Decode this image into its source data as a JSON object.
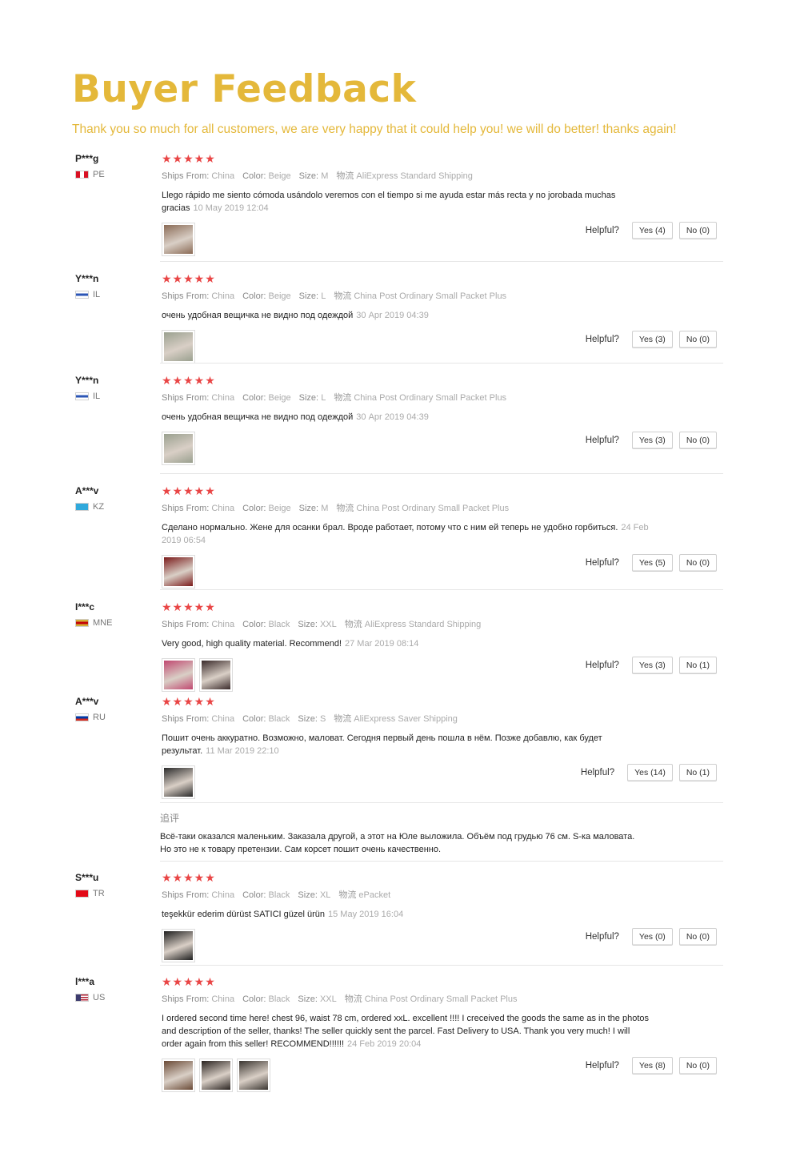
{
  "header": {
    "title": "Buyer Feedback",
    "subtitle": "Thank you so much for all customers, we are very happy that it could help you! we will do better! thanks again!"
  },
  "labels": {
    "ships_from": "Ships From:",
    "color": "Color:",
    "size": "Size:",
    "shipping_icon": "物流",
    "helpful": "Helpful?",
    "followup": "追评"
  },
  "reviews": [
    {
      "user": "P***g",
      "country": "PE",
      "flag_colors": [
        "#d91023",
        "#ffffff",
        "#d91023"
      ],
      "flag_icon": "peru-flag-icon",
      "stars": "★★★★★",
      "ships_from": "China",
      "color": "Beige",
      "size": "M",
      "shipping": "AliExpress Standard Shipping",
      "text": "Llego rápido me siento cómoda usándolo veremos con el tiempo si me ayuda estar más recta y no jorobada muchas gracias",
      "date": "10 May 2019 12:04",
      "thumbs": [
        "#8a6a55"
      ],
      "yes": "Yes (4)",
      "no": "No (0)"
    },
    {
      "user": "Y***n",
      "country": "IL",
      "flag_colors": [
        "#ffffff",
        "#2b55b5",
        "#ffffff"
      ],
      "flag_icon": "israel-flag-icon",
      "stars": "★★★★★",
      "ships_from": "China",
      "color": "Beige",
      "size": "L",
      "shipping": "China Post Ordinary Small Packet Plus",
      "text": "очень удобная вещичка не видно под одеждой",
      "date": "30 Apr 2019 04:39",
      "thumbs": [
        "#9aa08f"
      ],
      "yes": "Yes (3)",
      "no": "No (0)"
    },
    {
      "user": "Y***n",
      "country": "IL",
      "flag_colors": [
        "#ffffff",
        "#2b55b5",
        "#ffffff"
      ],
      "flag_icon": "israel-flag-icon",
      "stars": "★★★★★",
      "ships_from": "China",
      "color": "Beige",
      "size": "L",
      "shipping": "China Post Ordinary Small Packet Plus",
      "text": "очень удобная вещичка не видно под одеждой",
      "date": "30 Apr 2019 04:39",
      "thumbs": [
        "#9aa08f"
      ],
      "yes": "Yes (3)",
      "no": "No (0)"
    },
    {
      "user": "A***v",
      "country": "KZ",
      "flag_colors": [
        "#30a9dc",
        "#30a9dc",
        "#30a9dc"
      ],
      "flag_icon": "kazakhstan-flag-icon",
      "stars": "★★★★★",
      "ships_from": "China",
      "color": "Beige",
      "size": "M",
      "shipping": "China Post Ordinary Small Packet Plus",
      "text": "Сделано нормально. Жене для осанки брал. Вроде работает, потому что с ним ей теперь не удобно горбиться.",
      "date": "24 Feb 2019 06:54",
      "thumbs": [
        "#7a1a1a"
      ],
      "yes": "Yes (5)",
      "no": "No (0)"
    },
    {
      "user": "I***c",
      "country": "MNE",
      "flag_colors": [
        "#d4af37",
        "#c40308",
        "#d4af37"
      ],
      "flag_icon": "montenegro-flag-icon",
      "stars": "★★★★★",
      "ships_from": "China",
      "color": "Black",
      "size": "XXL",
      "shipping": "AliExpress Standard Shipping",
      "text": "Very good, high quality material. Recommend!",
      "date": "27 Mar 2019 08:14",
      "thumbs": [
        "#c04870",
        "#3a2a2a"
      ],
      "yes": "Yes (3)",
      "no": "No (1)"
    },
    {
      "user": "A***v",
      "country": "RU",
      "flag_colors": [
        "#ffffff",
        "#0039a6",
        "#d52b1e"
      ],
      "flag_icon": "russia-flag-icon",
      "stars": "★★★★★",
      "ships_from": "China",
      "color": "Black",
      "size": "S",
      "shipping": "AliExpress Saver Shipping",
      "text": "Пошит очень аккуратно. Возможно, маловат. Сегодня первый день пошла в нём. Позже добавлю, как будет результат.",
      "date": "11 Mar 2019 22:10",
      "thumbs": [
        "#2a2a2a"
      ],
      "yes": "Yes (14)",
      "no": "No (1)",
      "followup": "Всё-таки оказался маленьким. Заказала другой, а этот на Юле выложила. Объём под грудью 76 см. S-ка маловата. Но это не к товару претензии. Сам корсет пошит очень качественно."
    },
    {
      "user": "S***u",
      "country": "TR",
      "flag_colors": [
        "#e30a17",
        "#e30a17",
        "#e30a17"
      ],
      "flag_icon": "turkey-flag-icon",
      "stars": "★★★★★",
      "ships_from": "China",
      "color": "Black",
      "size": "XL",
      "shipping": "ePacket",
      "text": "teşekkür ederim dürüst SATICI güzel ürün",
      "date": "15 May 2019 16:04",
      "thumbs": [
        "#1e1e1e"
      ],
      "yes": "Yes (0)",
      "no": "No (0)"
    },
    {
      "user": "l***a",
      "country": "US",
      "flag_colors": [
        "#b22234",
        "#ffffff",
        "#3c3b6e"
      ],
      "flag_icon": "usa-flag-icon",
      "stars": "★★★★★",
      "ships_from": "China",
      "color": "Black",
      "size": "XXL",
      "shipping": "China Post Ordinary Small Packet Plus",
      "text": "I ordered second time here! chest 96, waist 78 cm, ordered xxL. excellent !!!! I creceived the goods the same as in the photos and description of the seller, thanks! The seller quickly sent the parcel. Fast Delivery to USA. Thank you very much! I will order again from this seller! RECOMMEND!!!!!!",
      "date": "24 Feb 2019 20:04",
      "thumbs": [
        "#6a4a36",
        "#2a2320",
        "#3a3530"
      ],
      "yes": "Yes (8)",
      "no": "No (0)"
    }
  ]
}
